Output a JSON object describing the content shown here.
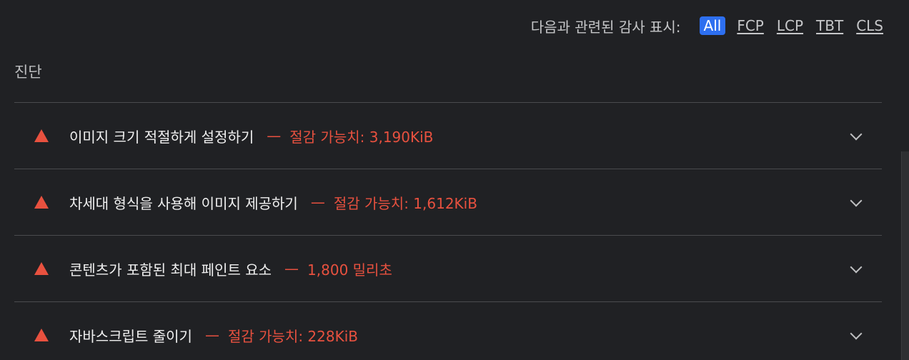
{
  "filter": {
    "label": "다음과 관련된 감사 표시:",
    "chips": [
      "All",
      "FCP",
      "LCP",
      "TBT",
      "CLS"
    ],
    "active": "All"
  },
  "section": {
    "title": "진단"
  },
  "audits": [
    {
      "title": "이미지 크기 적절하게 설정하기",
      "separator": "—",
      "value": "절감 가능치: 3,190KiB"
    },
    {
      "title": "차세대 형식을 사용해 이미지 제공하기",
      "separator": "—",
      "value": "절감 가능치: 1,612KiB"
    },
    {
      "title": "콘텐츠가 포함된 최대 페인트 요소",
      "separator": "—",
      "value": "1,800 밀리초"
    },
    {
      "title": "자바스크립트 줄이기",
      "separator": "—",
      "value": "절감 가능치: 228KiB"
    }
  ],
  "colors": {
    "background": "#202124",
    "accent": "#2d6ff0",
    "fail": "#e8513f"
  }
}
